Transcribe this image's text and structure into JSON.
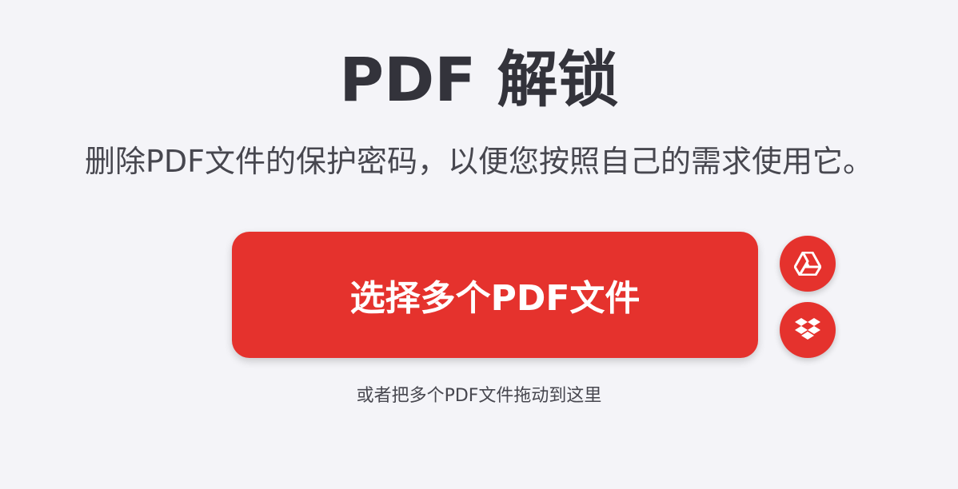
{
  "header": {
    "title": "PDF 解锁",
    "subtitle": "删除PDF文件的保护密码，以便您按照自己的需求使用它。"
  },
  "upload": {
    "select_button_label": "选择多个PDF文件",
    "drop_hint": "或者把多个PDF文件拖动到这里",
    "cloud_sources": [
      {
        "icon": "google-drive-icon"
      },
      {
        "icon": "dropbox-icon"
      }
    ]
  },
  "colors": {
    "accent": "#e5322d",
    "background": "#f4f4f8",
    "title_text": "#33333b",
    "body_text": "#47474f"
  }
}
